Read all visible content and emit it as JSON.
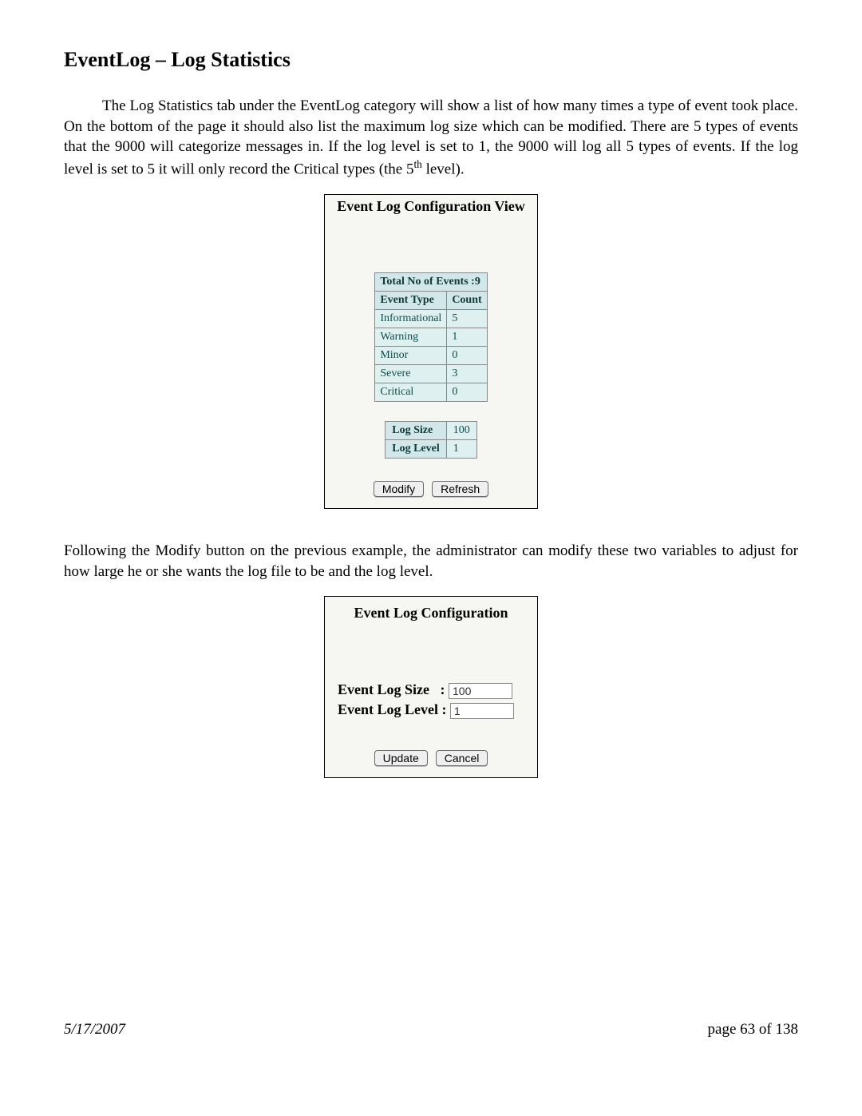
{
  "heading": "EventLog – Log Statistics",
  "para1_a": "The Log Statistics tab under the EventLog category will show a list of how many times a type of event took place.  On the bottom of the page it should also list the maximum log size which can be modified.  There are 5 types of events that the 9000 will categorize messages in.  If the log level is set to 1, the 9000 will log all 5 types of events.  If the log level is set to 5 it will only record the Critical types (the 5",
  "para1_sup": "th",
  "para1_b": " level).",
  "para2": "Following the Modify button on the previous example, the administrator can modify these two variables to adjust for how large he or she wants the log file to be and the log level.",
  "view_panel": {
    "title": "Event Log Configuration View",
    "total_label": "Total No of Events :",
    "total_value": "9",
    "col_type": "Event Type",
    "col_count": "Count",
    "rows": [
      {
        "type": "Informational",
        "count": "5"
      },
      {
        "type": "Warning",
        "count": "1"
      },
      {
        "type": "Minor",
        "count": "0"
      },
      {
        "type": "Severe",
        "count": "3"
      },
      {
        "type": "Critical",
        "count": "0"
      }
    ],
    "size_label": "Log Size",
    "size_value": "100",
    "level_label": "Log Level",
    "level_value": "1",
    "modify_btn": "Modify",
    "refresh_btn": "Refresh"
  },
  "edit_panel": {
    "title": "Event Log Configuration",
    "size_label": "Event Log Size",
    "size_sep": ":",
    "size_value": "100",
    "level_label": "Event Log Level :",
    "level_value": "1",
    "update_btn": "Update",
    "cancel_btn": "Cancel"
  },
  "footer_date": "5/17/2007",
  "footer_page": "page 63 of 138"
}
